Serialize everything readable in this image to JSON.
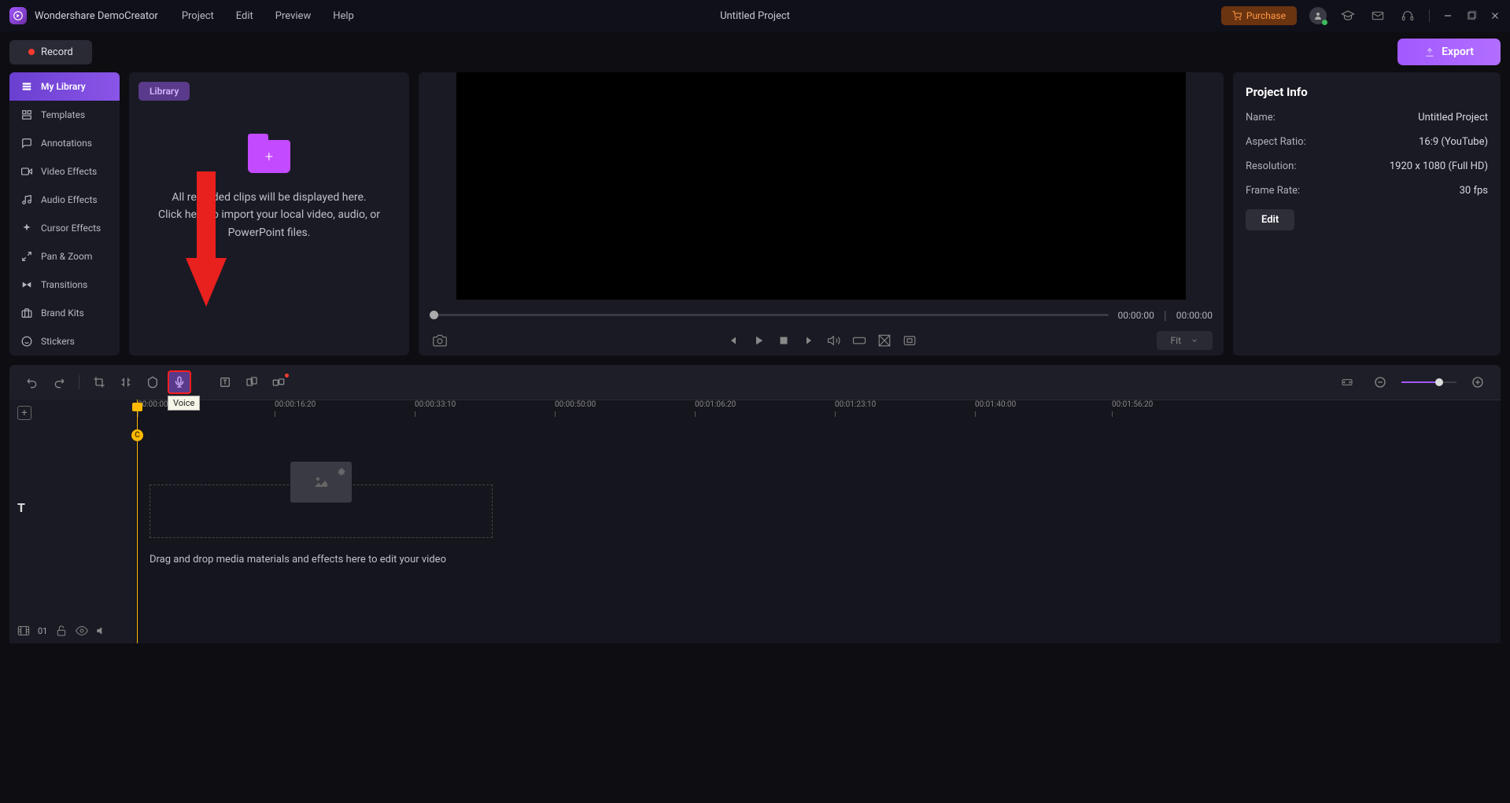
{
  "app": {
    "name": "Wondershare DemoCreator",
    "project_title": "Untitled Project"
  },
  "menu": [
    "Project",
    "Edit",
    "Preview",
    "Help"
  ],
  "titlebar": {
    "purchase": "Purchase"
  },
  "toolbar": {
    "record": "Record",
    "export": "Export"
  },
  "sidebar": {
    "items": [
      {
        "label": "My Library",
        "active": true
      },
      {
        "label": "Templates"
      },
      {
        "label": "Annotations"
      },
      {
        "label": "Video Effects"
      },
      {
        "label": "Audio Effects"
      },
      {
        "label": "Cursor Effects"
      },
      {
        "label": "Pan & Zoom"
      },
      {
        "label": "Transitions"
      },
      {
        "label": "Brand Kits"
      },
      {
        "label": "Stickers"
      }
    ]
  },
  "library": {
    "tag": "Library",
    "text1": "All recorded clips will be displayed here.",
    "text2": "Click here to import your local video, audio, or PowerPoint files."
  },
  "preview": {
    "time_current": "00:00:00",
    "time_total": "00:00:00",
    "fit": "Fit"
  },
  "info": {
    "title": "Project Info",
    "rows": [
      {
        "label": "Name:",
        "value": "Untitled Project"
      },
      {
        "label": "Aspect Ratio:",
        "value": "16:9 (YouTube)"
      },
      {
        "label": "Resolution:",
        "value": "1920 x 1080 (Full HD)"
      },
      {
        "label": "Frame Rate:",
        "value": "30 fps"
      }
    ],
    "edit": "Edit"
  },
  "timeline": {
    "ticks": [
      "00:00:00:00",
      "00:00:16:20",
      "00:00:33:10",
      "00:00:50:00",
      "00:01:06:20",
      "00:01:23:10",
      "00:01:40:00",
      "00:01:56:20"
    ],
    "drop_text": "Drag and drop media materials and effects here to edit your video",
    "track_count": "01",
    "tooltip": "Voice"
  }
}
